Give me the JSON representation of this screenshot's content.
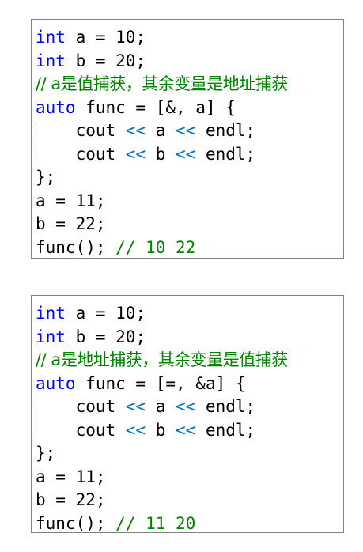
{
  "snippets": [
    {
      "lines": [
        {
          "parts": [
            {
              "t": "int",
              "c": "kw"
            },
            {
              "t": " a = 10;",
              "c": ""
            }
          ]
        },
        {
          "parts": [
            {
              "t": "int",
              "c": "kw"
            },
            {
              "t": " b = 20;",
              "c": ""
            }
          ]
        },
        {
          "parts": [
            {
              "t": "// a是值捕获，其余变量是地址捕获",
              "c": "cm zh"
            }
          ]
        },
        {
          "parts": [
            {
              "t": "auto",
              "c": "kw"
            },
            {
              "t": " func = [&, a] {",
              "c": ""
            }
          ]
        },
        {
          "parts": [
            {
              "t": "    cout ",
              "c": ""
            },
            {
              "t": "<<",
              "c": "op"
            },
            {
              "t": " a ",
              "c": ""
            },
            {
              "t": "<<",
              "c": "op"
            },
            {
              "t": " endl;",
              "c": ""
            }
          ],
          "guide": true
        },
        {
          "parts": [
            {
              "t": "    cout ",
              "c": ""
            },
            {
              "t": "<<",
              "c": "op"
            },
            {
              "t": " b ",
              "c": ""
            },
            {
              "t": "<<",
              "c": "op"
            },
            {
              "t": " endl;",
              "c": ""
            }
          ],
          "guide": true
        },
        {
          "parts": [
            {
              "t": "};",
              "c": ""
            }
          ]
        },
        {
          "parts": [
            {
              "t": "a = 11;",
              "c": ""
            }
          ]
        },
        {
          "parts": [
            {
              "t": "b = 22;",
              "c": ""
            }
          ]
        },
        {
          "parts": [
            {
              "t": "func(); ",
              "c": ""
            },
            {
              "t": "// 10 22",
              "c": "cm"
            }
          ]
        }
      ]
    },
    {
      "lines": [
        {
          "parts": [
            {
              "t": "int",
              "c": "kw"
            },
            {
              "t": " a = 10;",
              "c": ""
            }
          ]
        },
        {
          "parts": [
            {
              "t": "int",
              "c": "kw"
            },
            {
              "t": " b = 20;",
              "c": ""
            }
          ]
        },
        {
          "parts": [
            {
              "t": "// a是地址捕获，其余变量是值捕获",
              "c": "cm zh"
            }
          ]
        },
        {
          "parts": [
            {
              "t": "auto",
              "c": "kw"
            },
            {
              "t": " func = [=, &a] {",
              "c": ""
            }
          ]
        },
        {
          "parts": [
            {
              "t": "    cout ",
              "c": ""
            },
            {
              "t": "<<",
              "c": "op"
            },
            {
              "t": " a ",
              "c": ""
            },
            {
              "t": "<<",
              "c": "op"
            },
            {
              "t": " endl;",
              "c": ""
            }
          ],
          "guide": true
        },
        {
          "parts": [
            {
              "t": "    cout ",
              "c": ""
            },
            {
              "t": "<<",
              "c": "op"
            },
            {
              "t": " b ",
              "c": ""
            },
            {
              "t": "<<",
              "c": "op"
            },
            {
              "t": " endl;",
              "c": ""
            }
          ],
          "guide": true
        },
        {
          "parts": [
            {
              "t": "};",
              "c": ""
            }
          ]
        },
        {
          "parts": [
            {
              "t": "a = 11;",
              "c": ""
            }
          ]
        },
        {
          "parts": [
            {
              "t": "b = 22;",
              "c": ""
            }
          ]
        },
        {
          "parts": [
            {
              "t": "func(); ",
              "c": ""
            },
            {
              "t": "// 11 20",
              "c": "cm"
            }
          ]
        }
      ]
    }
  ],
  "colors": {
    "keyword": "#0000ff",
    "comment": "#008000",
    "operator": "#0070c0",
    "text": "#000000",
    "border": "#808080"
  }
}
